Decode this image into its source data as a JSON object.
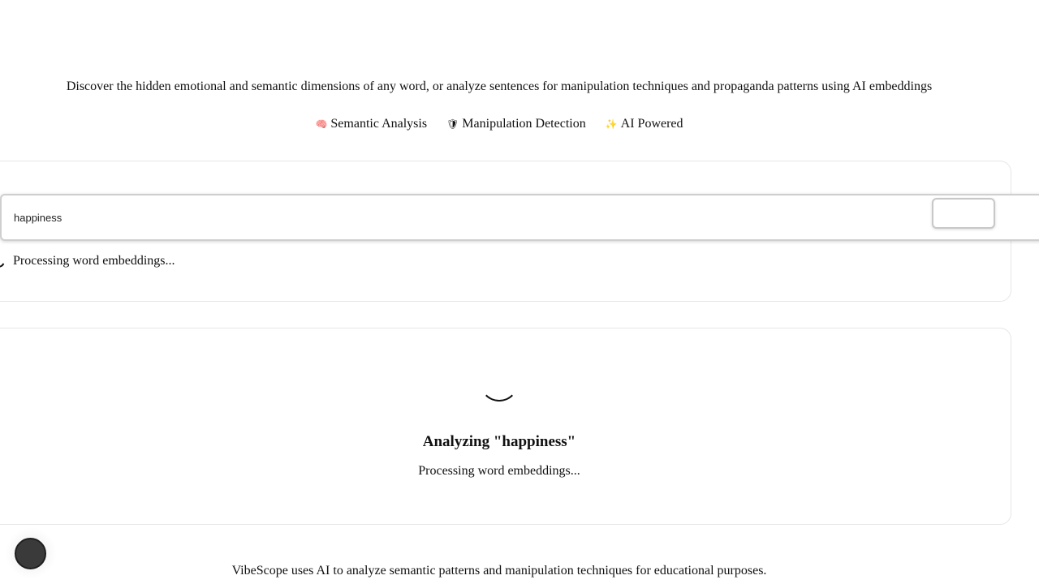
{
  "header": {
    "subtitle": "Discover the hidden emotional and semantic dimensions of any word, or analyze sentences for manipulation techniques and propaganda patterns using AI embeddings",
    "features": [
      {
        "icon": "brain-icon",
        "glyph": "🧠",
        "label": "Semantic Analysis"
      },
      {
        "icon": "shield-icon",
        "glyph": "🛡",
        "label": "Manipulation Detection"
      },
      {
        "icon": "sparkles-icon",
        "glyph": "✨",
        "label": "AI Powered"
      }
    ]
  },
  "search": {
    "value": "happiness",
    "button_label": "",
    "status": "Processing word embeddings..."
  },
  "result": {
    "title": "Analyzing \"happiness\"",
    "subtitle": "Processing word embeddings..."
  },
  "footer": {
    "text": "VibeScope uses AI to analyze semantic patterns and manipulation techniques for educational purposes."
  },
  "colors": {
    "text": "#111111",
    "card_border": "#e6e6e6",
    "fab": "#3a3a3a"
  }
}
